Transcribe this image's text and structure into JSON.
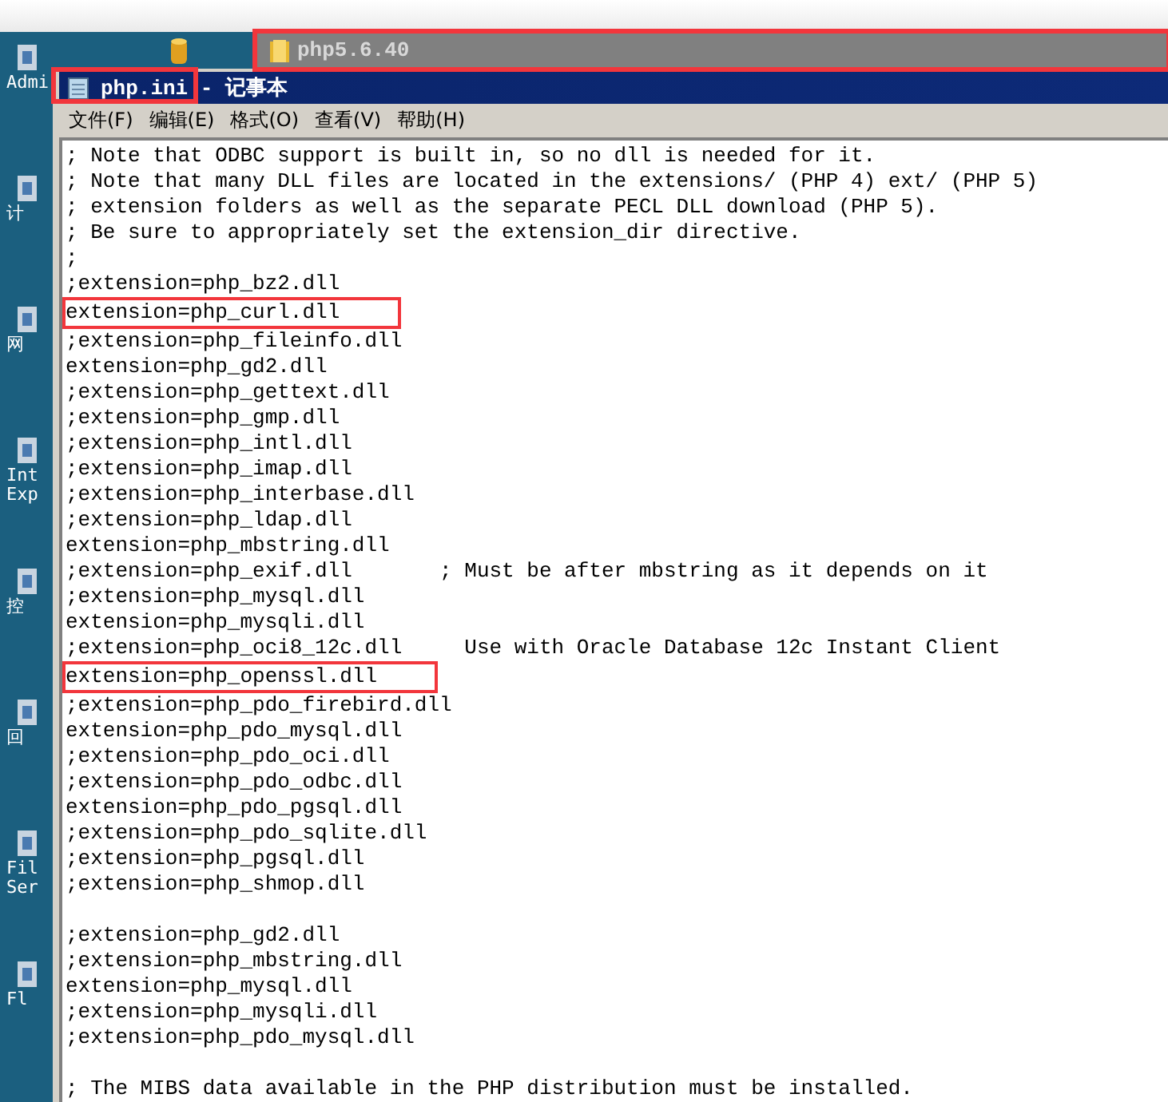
{
  "desktop": {
    "icons": [
      {
        "label": "Admi"
      },
      {
        "label": "计"
      },
      {
        "label": "网"
      },
      {
        "label": "Int Exp"
      },
      {
        "label": "控"
      },
      {
        "label": "回"
      },
      {
        "label": "Fil Ser"
      },
      {
        "label": "Fl"
      }
    ]
  },
  "folder_window": {
    "title": "php5.6.40",
    "highlighted": true
  },
  "window": {
    "title": "php.ini - 记事本",
    "title_highlighted": true
  },
  "menu": [
    "文件(F)",
    "编辑(E)",
    "格式(O)",
    "查看(V)",
    "帮助(H)"
  ],
  "lines": [
    {
      "kind": "code",
      "text": "; Note that ODBC support is built in, so no dll is needed for it.",
      "highlighted": false
    },
    {
      "kind": "code",
      "text": "; Note that many DLL files are located in the extensions/ (PHP 4) ext/ (PHP 5)",
      "highlighted": false
    },
    {
      "kind": "code",
      "text": "; extension folders as well as the separate PECL DLL download (PHP 5).",
      "highlighted": false
    },
    {
      "kind": "code",
      "text": "; Be sure to appropriately set the extension_dir directive.",
      "highlighted": false
    },
    {
      "kind": "code",
      "text": ";",
      "highlighted": false
    },
    {
      "kind": "code",
      "text": ";extension=php_bz2.dll",
      "highlighted": false
    },
    {
      "kind": "code",
      "text": "extension=php_curl.dll",
      "highlighted": true
    },
    {
      "kind": "code",
      "text": ";extension=php_fileinfo.dll",
      "highlighted": false
    },
    {
      "kind": "code",
      "text": "extension=php_gd2.dll",
      "highlighted": false
    },
    {
      "kind": "code",
      "text": ";extension=php_gettext.dll",
      "highlighted": false
    },
    {
      "kind": "code",
      "text": ";extension=php_gmp.dll",
      "highlighted": false
    },
    {
      "kind": "code",
      "text": ";extension=php_intl.dll",
      "highlighted": false
    },
    {
      "kind": "code",
      "text": ";extension=php_imap.dll",
      "highlighted": false
    },
    {
      "kind": "code",
      "text": ";extension=php_interbase.dll",
      "highlighted": false
    },
    {
      "kind": "code",
      "text": ";extension=php_ldap.dll",
      "highlighted": false
    },
    {
      "kind": "code",
      "text": "extension=php_mbstring.dll",
      "highlighted": false
    },
    {
      "kind": "code",
      "text": ";extension=php_exif.dll       ; Must be after mbstring as it depends on it",
      "highlighted": false
    },
    {
      "kind": "code",
      "text": ";extension=php_mysql.dll",
      "highlighted": false
    },
    {
      "kind": "code",
      "text": "extension=php_mysqli.dll",
      "highlighted": false
    },
    {
      "kind": "code",
      "text": ";extension=php_oci8_12c.dll     Use with Oracle Database 12c Instant Client",
      "highlighted": false
    },
    {
      "kind": "code",
      "text": "extension=php_openssl.dll",
      "highlighted": true
    },
    {
      "kind": "code",
      "text": ";extension=php_pdo_firebird.dll",
      "highlighted": false
    },
    {
      "kind": "code",
      "text": "extension=php_pdo_mysql.dll",
      "highlighted": false
    },
    {
      "kind": "code",
      "text": ";extension=php_pdo_oci.dll",
      "highlighted": false
    },
    {
      "kind": "code",
      "text": ";extension=php_pdo_odbc.dll",
      "highlighted": false
    },
    {
      "kind": "code",
      "text": "extension=php_pdo_pgsql.dll",
      "highlighted": false
    },
    {
      "kind": "code",
      "text": ";extension=php_pdo_sqlite.dll",
      "highlighted": false
    },
    {
      "kind": "code",
      "text": ";extension=php_pgsql.dll",
      "highlighted": false
    },
    {
      "kind": "code",
      "text": ";extension=php_shmop.dll",
      "highlighted": false
    },
    {
      "kind": "blank"
    },
    {
      "kind": "code",
      "text": ";extension=php_gd2.dll",
      "highlighted": false
    },
    {
      "kind": "code",
      "text": ";extension=php_mbstring.dll",
      "highlighted": false
    },
    {
      "kind": "code",
      "text": "extension=php_mysql.dll",
      "highlighted": false
    },
    {
      "kind": "code",
      "text": ";extension=php_mysqli.dll",
      "highlighted": false
    },
    {
      "kind": "code",
      "text": ";extension=php_pdo_mysql.dll",
      "highlighted": false
    },
    {
      "kind": "blank"
    },
    {
      "kind": "code",
      "text": "; The MIBS data available in the PHP distribution must be installed.",
      "highlighted": false
    }
  ]
}
